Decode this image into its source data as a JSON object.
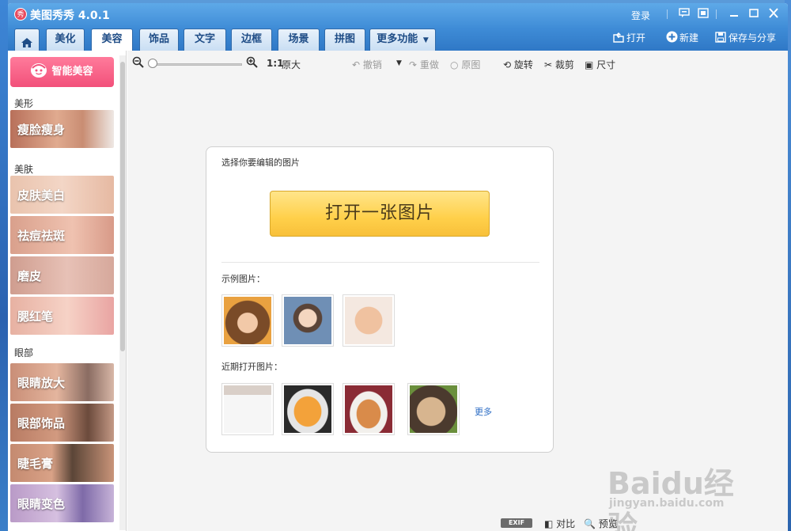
{
  "window": {
    "app_logo_text": "秀",
    "title": "美图秀秀 4.0.1",
    "login_label": "登录"
  },
  "tabs": [
    {
      "label": "",
      "icon": "home-icon"
    },
    {
      "label": "美化"
    },
    {
      "label": "美容",
      "active": true
    },
    {
      "label": "饰品"
    },
    {
      "label": "文字"
    },
    {
      "label": "边框"
    },
    {
      "label": "场景"
    },
    {
      "label": "拼图"
    },
    {
      "label": "更多功能",
      "icon": "caret-down-icon"
    }
  ],
  "top_actions": {
    "open_label": "打开",
    "new_label": "新建",
    "save_label": "保存与分享"
  },
  "sidebar": {
    "smart_button_label": "智能美容",
    "sections": [
      {
        "label": "美形",
        "items": [
          "瘦脸瘦身"
        ]
      },
      {
        "label": "美肤",
        "items": [
          "皮肤美白",
          "祛痘祛斑",
          "磨皮",
          "腮红笔"
        ]
      },
      {
        "label": "眼部",
        "items": [
          "眼睛放大",
          "眼部饰品",
          "睫毛膏",
          "眼睛变色"
        ]
      }
    ]
  },
  "toolbar": {
    "zoom_ratio": "1:1",
    "original_size_label": "原大",
    "undo_label": "撤销",
    "redo_label": "重做",
    "restore_label": "原图",
    "rotate_label": "旋转",
    "crop_label": "裁剪",
    "resize_label": "尺寸"
  },
  "panel": {
    "title": "选择你要编辑的图片",
    "open_button_label": "打开一张图片",
    "sample_label": "示例图片：",
    "recent_label": "近期打开图片：",
    "more_label": "更多"
  },
  "statusbar": {
    "exif_label": "EXIF",
    "compare_label": "对比",
    "preview_label": "预览"
  },
  "watermark": {
    "main": "Baidu经验",
    "sub": "jingyan.baidu.com"
  },
  "colors": {
    "titlebar": "#3e8bd6",
    "tab_text": "#1e4c86",
    "smart_button": "#f2507a",
    "open_button": "#ffd04a",
    "link": "#2b6cc4"
  }
}
